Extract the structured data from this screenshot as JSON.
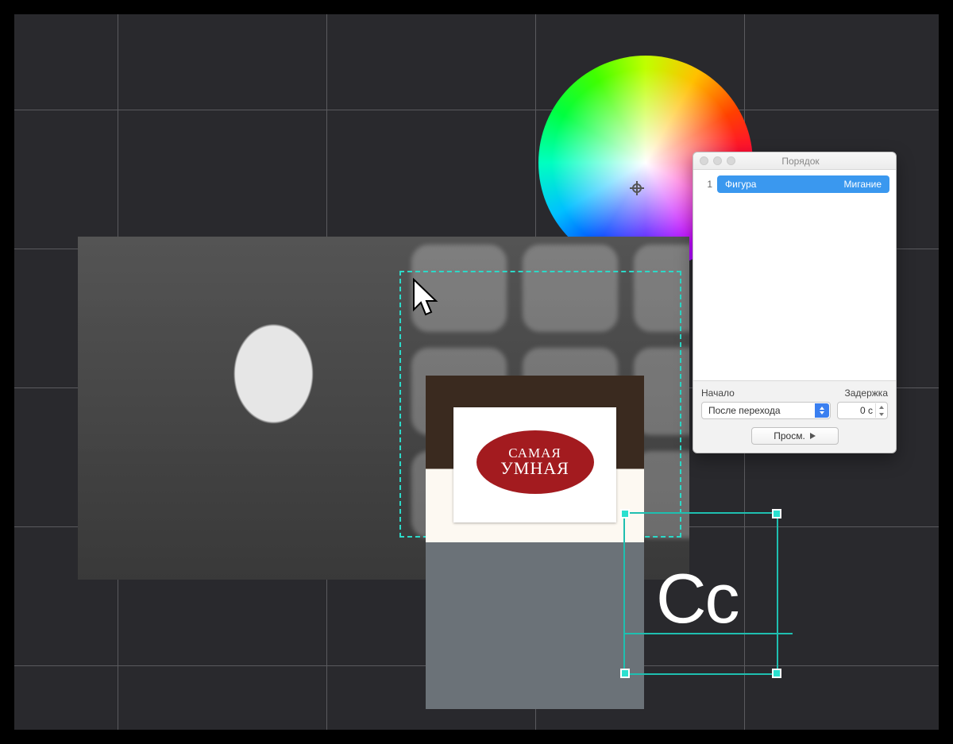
{
  "poster": {
    "line1": "САМАЯ",
    "line2": "УМНАЯ"
  },
  "type_sample": "Cc",
  "panel": {
    "title": "Порядок",
    "row_number": "1",
    "row_name": "Фигура",
    "row_effect": "Мигание",
    "start_label": "Начало",
    "delay_label": "Задержка",
    "start_value": "После перехода",
    "delay_value": "0 с",
    "preview_label": "Просм."
  }
}
